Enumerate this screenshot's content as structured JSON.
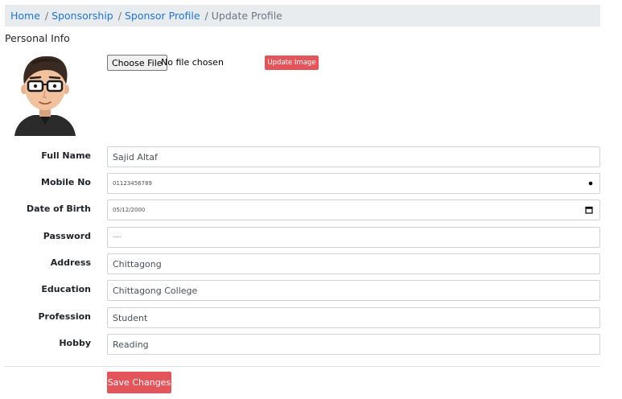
{
  "breadcrumb": {
    "items": [
      {
        "label": "Home"
      },
      {
        "label": "Sponsorship"
      },
      {
        "label": "Sponsor Profile"
      }
    ],
    "current": "Update Profile",
    "separator": "/"
  },
  "section_title": "Personal Info",
  "upload": {
    "choose_label": "Choose File",
    "status": "No file chosen",
    "update_button": "Update Image"
  },
  "fields": {
    "full_name": {
      "label": "Full Name",
      "value": "Sajid Altaf"
    },
    "mobile_no": {
      "label": "Mobile No",
      "value": "01123456789",
      "icon": "spinner-dot-icon"
    },
    "dob": {
      "label": "Date of Birth",
      "value": "05/12/2000",
      "icon": "calendar-icon"
    },
    "password": {
      "label": "Password",
      "value": "·····"
    },
    "address": {
      "label": "Address",
      "value": "Chittagong"
    },
    "education": {
      "label": "Education",
      "value": "Chittagong College"
    },
    "profession": {
      "label": "Profession",
      "value": "Student"
    },
    "hobby": {
      "label": "Hobby",
      "value": "Reading"
    }
  },
  "save_button": "Save Changes",
  "colors": {
    "link": "#1f74d2",
    "breadcrumb_bg": "#e9ecef",
    "danger": "#e4545b",
    "border": "#ced4da"
  }
}
